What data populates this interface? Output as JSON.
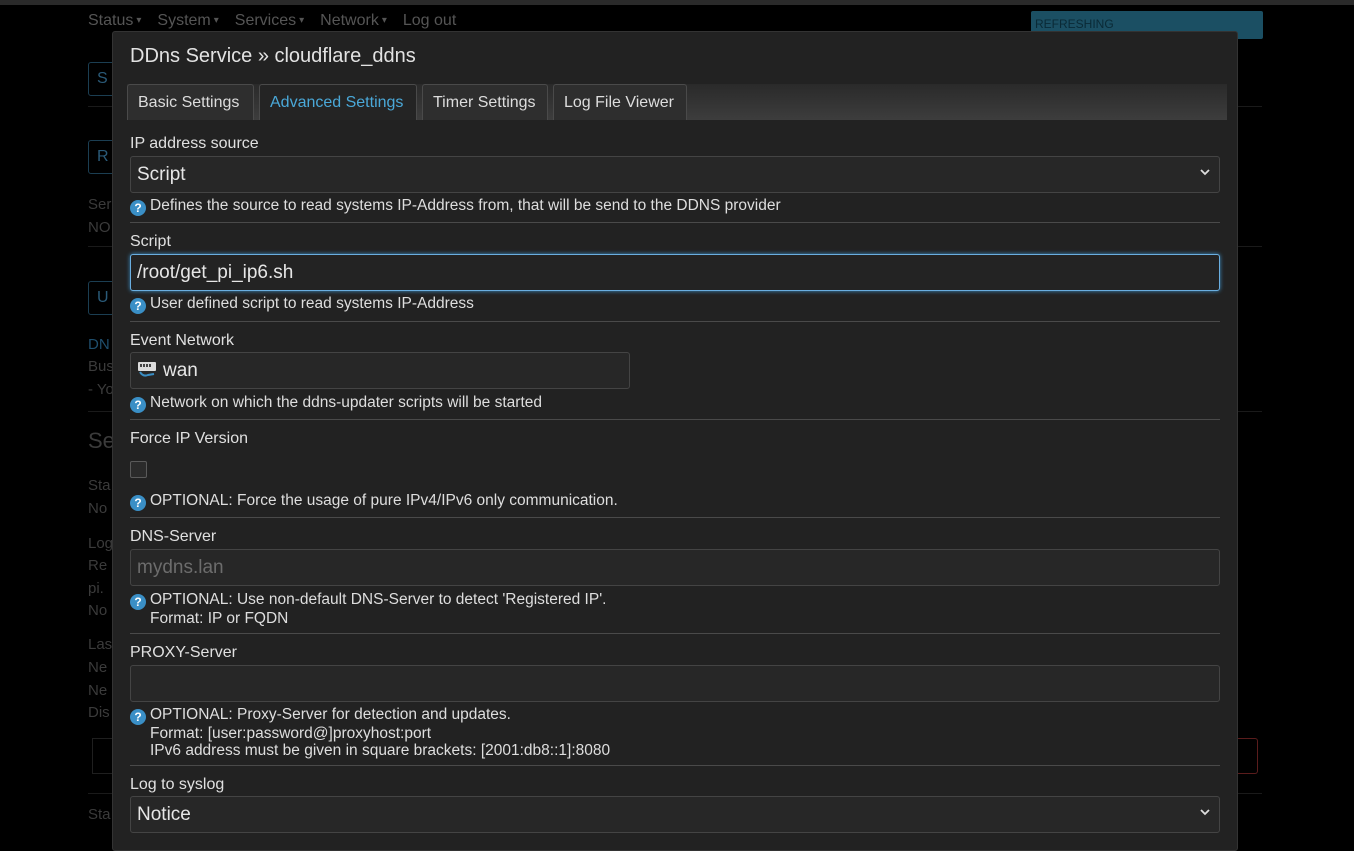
{
  "menu": [
    {
      "label": "Status"
    },
    {
      "label": "System"
    },
    {
      "label": "Services"
    },
    {
      "label": "Network"
    },
    {
      "label": "Log out"
    }
  ],
  "refresh_badge": "REFRESHING",
  "modal": {
    "title": "DDns Service » cloudflare_ddns",
    "tabs": [
      {
        "label": "Basic Settings",
        "active": false
      },
      {
        "label": "Advanced Settings",
        "active": true
      },
      {
        "label": "Timer Settings",
        "active": false
      },
      {
        "label": "Log File Viewer",
        "active": false
      }
    ],
    "fields": {
      "ip_source": {
        "label": "IP address source",
        "value": "Script",
        "help": "Defines the source to read systems IP-Address from, that will be send to the DDNS provider"
      },
      "script": {
        "label": "Script",
        "value": "/root/get_pi_ip6.sh",
        "help": "User defined script to read systems IP-Address"
      },
      "event_network": {
        "label": "Event Network",
        "value": "wan",
        "help": "Network on which the ddns-updater scripts will be started"
      },
      "force_ip": {
        "label": "Force IP Version",
        "checked": false,
        "help": "OPTIONAL: Force the usage of pure IPv4/IPv6 only communication."
      },
      "dns_server": {
        "label": "DNS-Server",
        "placeholder": "mydns.lan",
        "value": "",
        "help": "OPTIONAL: Use non-default DNS-Server to detect 'Registered IP'.",
        "help_line2": "Format: IP or FQDN"
      },
      "proxy_server": {
        "label": "PROXY-Server",
        "value": "",
        "help": "OPTIONAL: Proxy-Server for detection and updates.",
        "help_line2": "Format: [user:password@]proxyhost:port",
        "help_line3": "IPv6 address must be given in square brackets: [2001:db8::1]:8080"
      },
      "log_syslog": {
        "label": "Log to syslog",
        "value": "Notice"
      }
    }
  },
  "background": {
    "frag1": "S",
    "frag2": "R",
    "frag3a": "Ser",
    "frag3b": "NO",
    "frag4": "U",
    "frag5a": "DN",
    "frag5b": "Bus",
    "frag5c": "- Yo",
    "frag6": "Se",
    "frag7a": "Sta",
    "frag7b": "No",
    "frag8a": "Log",
    "frag8b": "Re",
    "frag8c": "pi.",
    "frag8d": "No",
    "frag9a": "Las",
    "frag9b": "Ne",
    "frag9c": "Ne",
    "frag9d": "Dis",
    "frag10": "Sta"
  },
  "icons": {
    "question": "question-icon",
    "network": "network-interface-icon",
    "chevron": "chevron-down-icon"
  },
  "colors": {
    "accent": "#4aa8d8",
    "help_icon": "#3a8fc6",
    "modal_bg": "#222222"
  }
}
